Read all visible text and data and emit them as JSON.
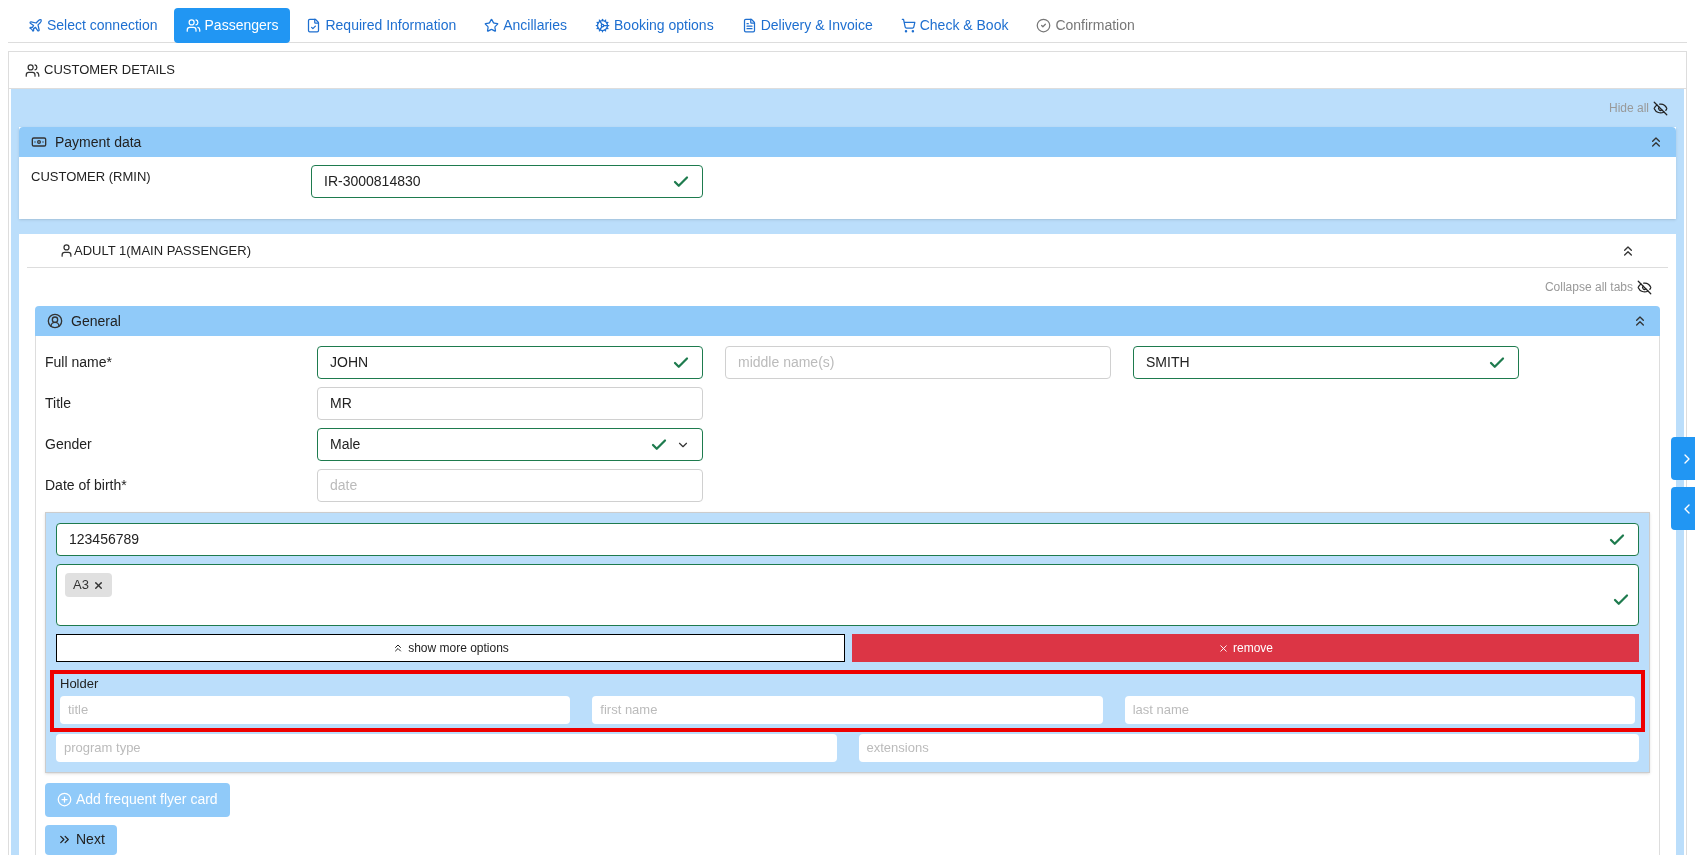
{
  "tabs": [
    {
      "label": "Select connection",
      "selected": false,
      "disabled": false
    },
    {
      "label": "Passengers",
      "selected": true,
      "disabled": false
    },
    {
      "label": "Required Information",
      "selected": false,
      "disabled": false
    },
    {
      "label": "Ancillaries",
      "selected": false,
      "disabled": false
    },
    {
      "label": "Booking options",
      "selected": false,
      "disabled": false
    },
    {
      "label": "Delivery & Invoice",
      "selected": false,
      "disabled": false
    },
    {
      "label": "Check & Book",
      "selected": false,
      "disabled": false
    },
    {
      "label": "Confirmation",
      "selected": false,
      "disabled": true
    }
  ],
  "customer_details": {
    "title": "CUSTOMER DETAILS",
    "hide_all": "Hide all",
    "payment": {
      "title": "Payment data",
      "expanded": true,
      "label": "CUSTOMER (RMIN)",
      "field": {
        "value": "IR-3000814830",
        "valid": true
      }
    },
    "passenger": {
      "title": "ADULT 1(MAIN PASSENGER)",
      "expanded": true,
      "collapse_all": "Collapse all tabs",
      "general": {
        "title": "General",
        "expanded": true,
        "rows": [
          {
            "label": "Full name*",
            "fields": [
              {
                "value": "JOHN",
                "valid": true
              },
              {
                "placeholder": "middle name(s)",
                "valid": false
              },
              {
                "value": "SMITH",
                "valid": true
              }
            ]
          },
          {
            "label": "Title",
            "fields": [
              {
                "value": "MR",
                "valid": false
              }
            ]
          },
          {
            "label": "Gender",
            "fields": [
              {
                "kind": "select",
                "value": "Male",
                "valid": true
              }
            ]
          },
          {
            "label": "Date of birth*",
            "fields": [
              {
                "placeholder": "date",
                "valid": false
              }
            ]
          }
        ]
      },
      "frequent_flyer": {
        "number": {
          "value": "123456789",
          "valid": true
        },
        "tags": {
          "items": [
            "A3"
          ],
          "valid": true
        },
        "show_more": "show more options",
        "remove": "remove",
        "holder": {
          "label": "Holder",
          "highlighted": true,
          "fields": [
            {
              "placeholder": "title"
            },
            {
              "placeholder": "first name"
            },
            {
              "placeholder": "last name"
            }
          ]
        },
        "extra_fields": [
          {
            "placeholder": "program type"
          },
          {
            "placeholder": "extensions"
          }
        ]
      },
      "add_button": "Add frequent flyer card",
      "next_button": "Next"
    }
  }
}
